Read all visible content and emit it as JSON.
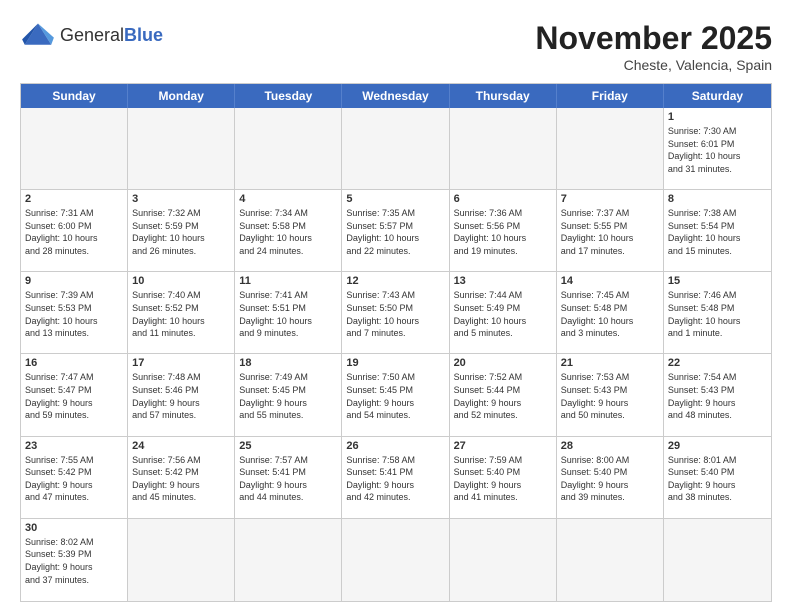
{
  "header": {
    "logo_general": "General",
    "logo_blue": "Blue",
    "month_title": "November 2025",
    "subtitle": "Cheste, Valencia, Spain"
  },
  "weekdays": [
    "Sunday",
    "Monday",
    "Tuesday",
    "Wednesday",
    "Thursday",
    "Friday",
    "Saturday"
  ],
  "rows": [
    [
      {
        "day": "",
        "info": "",
        "empty": true
      },
      {
        "day": "",
        "info": "",
        "empty": true
      },
      {
        "day": "",
        "info": "",
        "empty": true
      },
      {
        "day": "",
        "info": "",
        "empty": true
      },
      {
        "day": "",
        "info": "",
        "empty": true
      },
      {
        "day": "",
        "info": "",
        "empty": true
      },
      {
        "day": "1",
        "info": "Sunrise: 7:30 AM\nSunset: 6:01 PM\nDaylight: 10 hours\nand 31 minutes.",
        "empty": false
      }
    ],
    [
      {
        "day": "2",
        "info": "Sunrise: 7:31 AM\nSunset: 6:00 PM\nDaylight: 10 hours\nand 28 minutes.",
        "empty": false
      },
      {
        "day": "3",
        "info": "Sunrise: 7:32 AM\nSunset: 5:59 PM\nDaylight: 10 hours\nand 26 minutes.",
        "empty": false
      },
      {
        "day": "4",
        "info": "Sunrise: 7:34 AM\nSunset: 5:58 PM\nDaylight: 10 hours\nand 24 minutes.",
        "empty": false
      },
      {
        "day": "5",
        "info": "Sunrise: 7:35 AM\nSunset: 5:57 PM\nDaylight: 10 hours\nand 22 minutes.",
        "empty": false
      },
      {
        "day": "6",
        "info": "Sunrise: 7:36 AM\nSunset: 5:56 PM\nDaylight: 10 hours\nand 19 minutes.",
        "empty": false
      },
      {
        "day": "7",
        "info": "Sunrise: 7:37 AM\nSunset: 5:55 PM\nDaylight: 10 hours\nand 17 minutes.",
        "empty": false
      },
      {
        "day": "8",
        "info": "Sunrise: 7:38 AM\nSunset: 5:54 PM\nDaylight: 10 hours\nand 15 minutes.",
        "empty": false
      }
    ],
    [
      {
        "day": "9",
        "info": "Sunrise: 7:39 AM\nSunset: 5:53 PM\nDaylight: 10 hours\nand 13 minutes.",
        "empty": false
      },
      {
        "day": "10",
        "info": "Sunrise: 7:40 AM\nSunset: 5:52 PM\nDaylight: 10 hours\nand 11 minutes.",
        "empty": false
      },
      {
        "day": "11",
        "info": "Sunrise: 7:41 AM\nSunset: 5:51 PM\nDaylight: 10 hours\nand 9 minutes.",
        "empty": false
      },
      {
        "day": "12",
        "info": "Sunrise: 7:43 AM\nSunset: 5:50 PM\nDaylight: 10 hours\nand 7 minutes.",
        "empty": false
      },
      {
        "day": "13",
        "info": "Sunrise: 7:44 AM\nSunset: 5:49 PM\nDaylight: 10 hours\nand 5 minutes.",
        "empty": false
      },
      {
        "day": "14",
        "info": "Sunrise: 7:45 AM\nSunset: 5:48 PM\nDaylight: 10 hours\nand 3 minutes.",
        "empty": false
      },
      {
        "day": "15",
        "info": "Sunrise: 7:46 AM\nSunset: 5:48 PM\nDaylight: 10 hours\nand 1 minute.",
        "empty": false
      }
    ],
    [
      {
        "day": "16",
        "info": "Sunrise: 7:47 AM\nSunset: 5:47 PM\nDaylight: 9 hours\nand 59 minutes.",
        "empty": false
      },
      {
        "day": "17",
        "info": "Sunrise: 7:48 AM\nSunset: 5:46 PM\nDaylight: 9 hours\nand 57 minutes.",
        "empty": false
      },
      {
        "day": "18",
        "info": "Sunrise: 7:49 AM\nSunset: 5:45 PM\nDaylight: 9 hours\nand 55 minutes.",
        "empty": false
      },
      {
        "day": "19",
        "info": "Sunrise: 7:50 AM\nSunset: 5:45 PM\nDaylight: 9 hours\nand 54 minutes.",
        "empty": false
      },
      {
        "day": "20",
        "info": "Sunrise: 7:52 AM\nSunset: 5:44 PM\nDaylight: 9 hours\nand 52 minutes.",
        "empty": false
      },
      {
        "day": "21",
        "info": "Sunrise: 7:53 AM\nSunset: 5:43 PM\nDaylight: 9 hours\nand 50 minutes.",
        "empty": false
      },
      {
        "day": "22",
        "info": "Sunrise: 7:54 AM\nSunset: 5:43 PM\nDaylight: 9 hours\nand 48 minutes.",
        "empty": false
      }
    ],
    [
      {
        "day": "23",
        "info": "Sunrise: 7:55 AM\nSunset: 5:42 PM\nDaylight: 9 hours\nand 47 minutes.",
        "empty": false
      },
      {
        "day": "24",
        "info": "Sunrise: 7:56 AM\nSunset: 5:42 PM\nDaylight: 9 hours\nand 45 minutes.",
        "empty": false
      },
      {
        "day": "25",
        "info": "Sunrise: 7:57 AM\nSunset: 5:41 PM\nDaylight: 9 hours\nand 44 minutes.",
        "empty": false
      },
      {
        "day": "26",
        "info": "Sunrise: 7:58 AM\nSunset: 5:41 PM\nDaylight: 9 hours\nand 42 minutes.",
        "empty": false
      },
      {
        "day": "27",
        "info": "Sunrise: 7:59 AM\nSunset: 5:40 PM\nDaylight: 9 hours\nand 41 minutes.",
        "empty": false
      },
      {
        "day": "28",
        "info": "Sunrise: 8:00 AM\nSunset: 5:40 PM\nDaylight: 9 hours\nand 39 minutes.",
        "empty": false
      },
      {
        "day": "29",
        "info": "Sunrise: 8:01 AM\nSunset: 5:40 PM\nDaylight: 9 hours\nand 38 minutes.",
        "empty": false
      }
    ],
    [
      {
        "day": "30",
        "info": "Sunrise: 8:02 AM\nSunset: 5:39 PM\nDaylight: 9 hours\nand 37 minutes.",
        "empty": false
      },
      {
        "day": "",
        "info": "",
        "empty": true
      },
      {
        "day": "",
        "info": "",
        "empty": true
      },
      {
        "day": "",
        "info": "",
        "empty": true
      },
      {
        "day": "",
        "info": "",
        "empty": true
      },
      {
        "day": "",
        "info": "",
        "empty": true
      },
      {
        "day": "",
        "info": "",
        "empty": true
      }
    ]
  ]
}
